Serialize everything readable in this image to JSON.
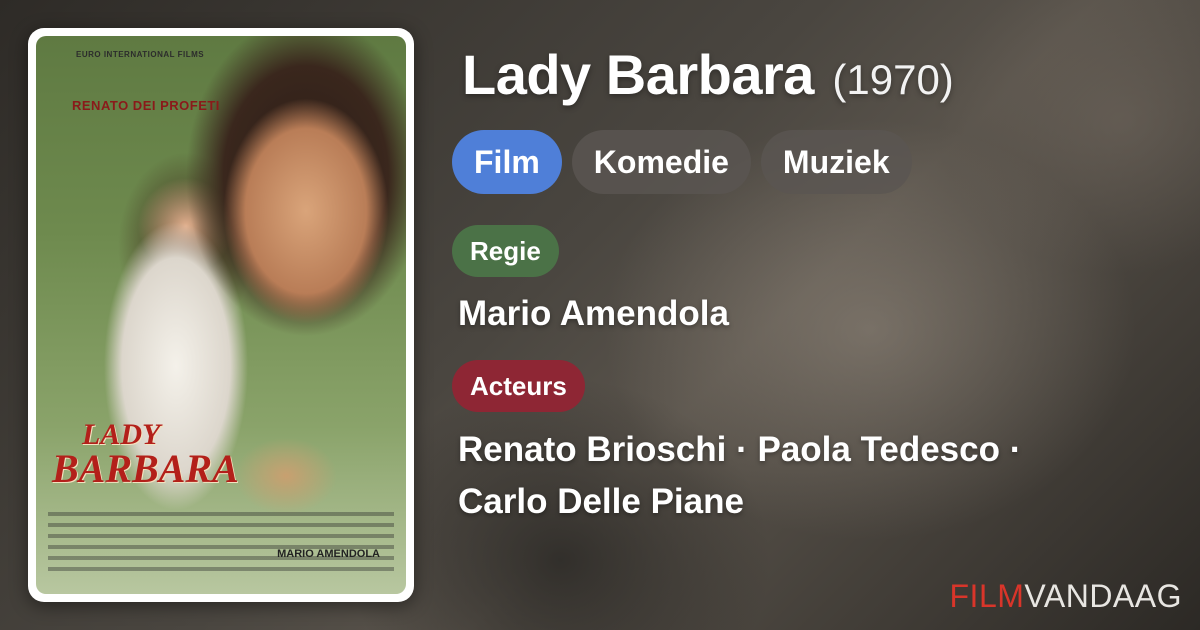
{
  "poster": {
    "studio_text": "EURO INTERNATIONAL FILMS",
    "star_text": "RENATO DEI PROFETI",
    "title_line1": "LADY",
    "title_line2": "BARBARA",
    "director_text": "MARIO AMENDOLA"
  },
  "movie": {
    "title": "Lady Barbara",
    "year": "(1970)"
  },
  "genres": [
    "Film",
    "Komedie",
    "Muziek"
  ],
  "sections": {
    "director_label": "Regie",
    "director": "Mario Amendola",
    "cast_label": "Acteurs",
    "cast_line1": "Renato Brioschi · Paola Tedesco ·",
    "cast_line2": "Carlo Delle Piane"
  },
  "brand": {
    "part1": "FILM",
    "part2": "VANDAAG"
  },
  "colors": {
    "film_chip": "#4f7fd8",
    "regie_label": "#4b7247",
    "acteurs_label": "#8e2634",
    "brand_red": "#d9352a"
  }
}
